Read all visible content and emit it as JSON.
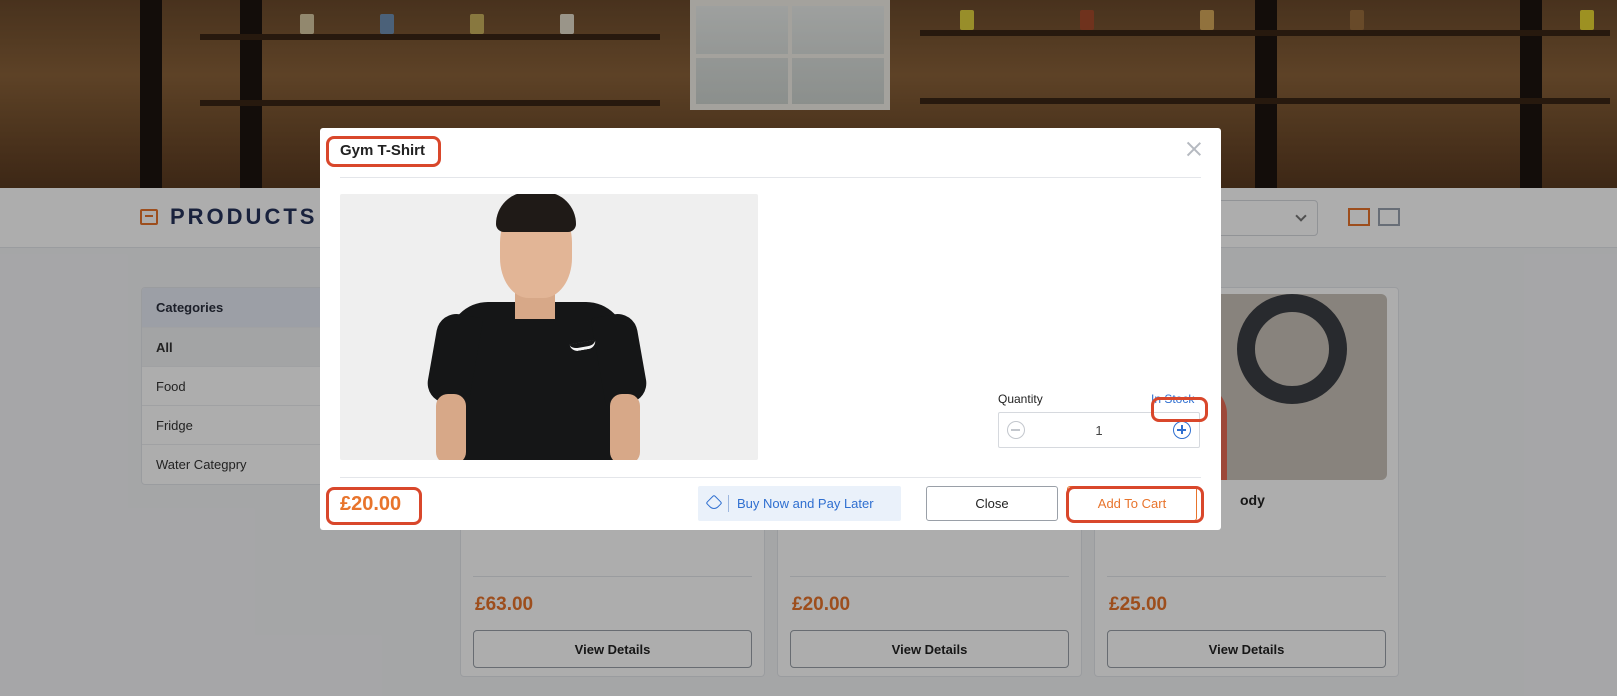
{
  "products_header": {
    "title": "PRODUCTS"
  },
  "categories": {
    "heading": "Categories",
    "items": [
      "All",
      "Food",
      "Fridge",
      "Water Categpry"
    ]
  },
  "cards": [
    {
      "name": "",
      "price": "£63.00",
      "button": "View Details"
    },
    {
      "name": "",
      "price": "£20.00",
      "button": "View Details"
    },
    {
      "name": "ody",
      "price": "£25.00",
      "button": "View Details"
    }
  ],
  "modal": {
    "title": "Gym T-Shirt",
    "quantity_label": "Quantity",
    "stock_status": "In Stock",
    "quantity_value": "1",
    "price": "£20.00",
    "bnpl_label": "Buy Now and Pay Later",
    "close_label": "Close",
    "add_to_cart_label": "Add To Cart"
  },
  "colors": {
    "accent": "#e8742c",
    "link": "#2f6fd0",
    "highlight": "#d9472b",
    "navy": "#26335a"
  }
}
